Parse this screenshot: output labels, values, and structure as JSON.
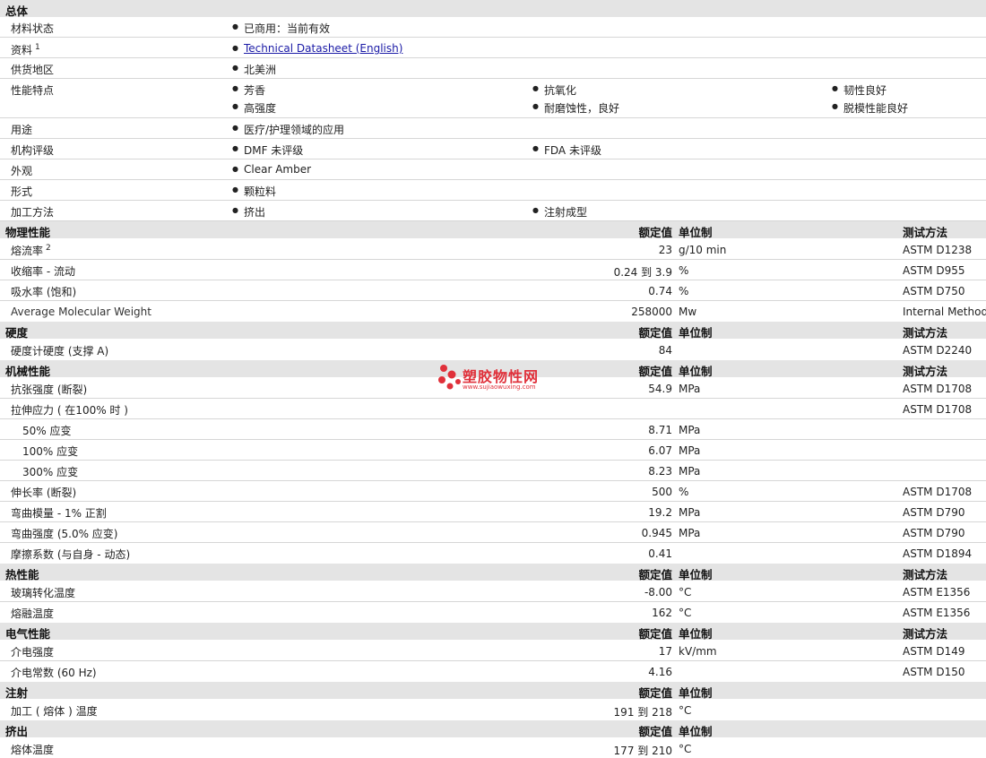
{
  "general": {
    "title": "总体",
    "status": {
      "label": "材料状态",
      "value": "已商用：当前有效"
    },
    "docs": {
      "label": "资料",
      "sup": "1",
      "link": "Technical Datasheet (English)"
    },
    "region": {
      "label": "供货地区",
      "value": "北美洲"
    },
    "features": {
      "label": "性能特点",
      "items": [
        "芳香",
        "抗氧化",
        "韧性良好",
        "高强度",
        "耐磨蚀性，良好",
        "脱模性能良好"
      ]
    },
    "uses": {
      "label": "用途",
      "value": "医疗/护理领域的应用"
    },
    "agency": {
      "label": "机构评级",
      "items": [
        "DMF 未评级",
        "FDA 未评级"
      ]
    },
    "appearance": {
      "label": "外观",
      "value": "Clear Amber"
    },
    "form": {
      "label": "形式",
      "value": "颗粒料"
    },
    "processing": {
      "label": "加工方法",
      "items": [
        "挤出",
        "注射成型"
      ]
    }
  },
  "headers": {
    "value": "额定值",
    "unit": "单位制",
    "method": "测试方法"
  },
  "physical": {
    "title": "物理性能",
    "rows": [
      {
        "label": "熔流率",
        "sup": "2",
        "value": "23",
        "unit": "g/10 min",
        "method": "ASTM D1238"
      },
      {
        "label": "收缩率 - 流动",
        "value": "0.24 到  3.9",
        "unit": "%",
        "method": "ASTM D955"
      },
      {
        "label": "吸水率 (饱和)",
        "value": "0.74",
        "unit": "%",
        "method": "ASTM D750"
      },
      {
        "label": "Average Molecular Weight",
        "value": "258000",
        "unit": "Mw",
        "method": "Internal Method"
      }
    ]
  },
  "hardness": {
    "title": "硬度",
    "rows": [
      {
        "label": "硬度计硬度 (支撑 A)",
        "value": "84",
        "unit": "",
        "method": "ASTM D2240"
      }
    ]
  },
  "mechanical": {
    "title": "机械性能",
    "rows": [
      {
        "label": "抗张强度 (断裂)",
        "value": "54.9",
        "unit": "MPa",
        "method": "ASTM D1708"
      },
      {
        "label": "拉伸应力 ( 在100% 时 )",
        "value": "",
        "unit": "",
        "method": "ASTM D1708"
      },
      {
        "label": "50% 应变",
        "value": "8.71",
        "unit": "MPa",
        "method": ""
      },
      {
        "label": "100% 应变",
        "value": "6.07",
        "unit": "MPa",
        "method": ""
      },
      {
        "label": "300% 应变",
        "value": "8.23",
        "unit": "MPa",
        "method": ""
      },
      {
        "label": "伸长率 (断裂)",
        "value": "500",
        "unit": "%",
        "method": "ASTM D1708"
      },
      {
        "label": "弯曲模量 - 1% 正割",
        "value": "19.2",
        "unit": "MPa",
        "method": "ASTM D790"
      },
      {
        "label": "弯曲强度 (5.0% 应变)",
        "value": "0.945",
        "unit": "MPa",
        "method": "ASTM D790"
      },
      {
        "label": "摩擦系数 (与自身 - 动态)",
        "value": "0.41",
        "unit": "",
        "method": "ASTM D1894"
      }
    ]
  },
  "thermal": {
    "title": "热性能",
    "rows": [
      {
        "label": "玻璃转化温度",
        "value": "-8.00",
        "unit": "°C",
        "method": "ASTM E1356"
      },
      {
        "label": "熔融温度",
        "value": "162",
        "unit": "°C",
        "method": "ASTM E1356"
      }
    ]
  },
  "electrical": {
    "title": "电气性能",
    "rows": [
      {
        "label": "介电强度",
        "value": "17",
        "unit": "kV/mm",
        "method": "ASTM D149"
      },
      {
        "label": "介电常数 (60 Hz)",
        "value": "4.16",
        "unit": "",
        "method": "ASTM D150"
      }
    ]
  },
  "injection": {
    "title": "注射",
    "rows": [
      {
        "label": "加工 ( 熔体 ) 温度",
        "value": "191 到  218",
        "unit": "°C",
        "method": ""
      }
    ]
  },
  "extrusion": {
    "title": "挤出",
    "rows": [
      {
        "label": "熔体温度",
        "value": "177 到  210",
        "unit": "°C",
        "method": ""
      }
    ]
  },
  "watermark": {
    "title": "塑胶物性网",
    "url": "www.sujiaowuxing.com",
    "color": "#e0303a"
  }
}
